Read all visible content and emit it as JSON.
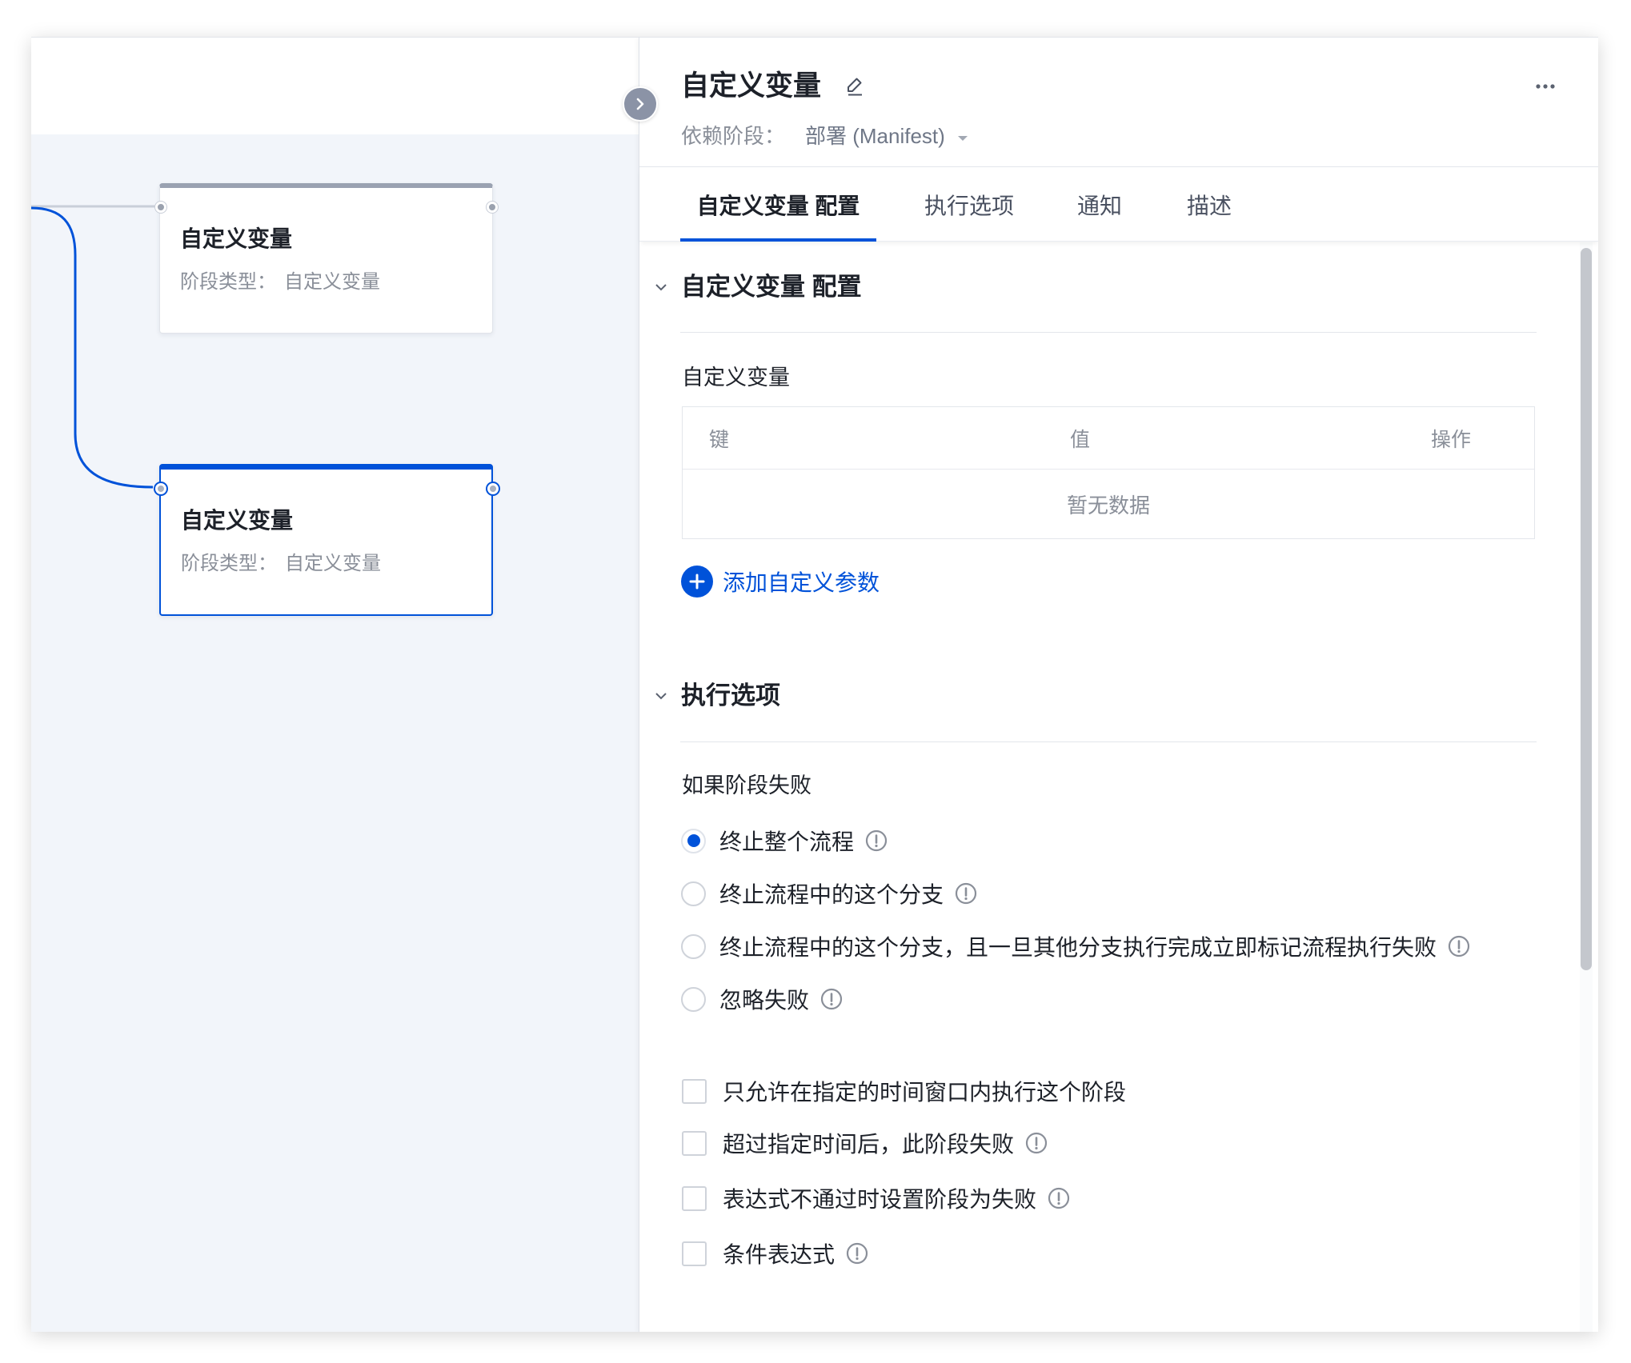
{
  "theme": {
    "accent": "#0052d9",
    "text_primary": "#1d2129",
    "text_secondary": "#8a8f99",
    "canvas_background": "#f2f5fa"
  },
  "canvas": {
    "collapse_icon": "chevron-right-icon",
    "nodes": [
      {
        "title": "自定义变量",
        "type_label": "阶段类型：",
        "type_value": "自定义变量",
        "selected": false
      },
      {
        "title": "自定义变量",
        "type_label": "阶段类型：",
        "type_value": "自定义变量",
        "selected": true
      }
    ]
  },
  "panel": {
    "title": "自定义变量",
    "title_icon": "pencil-icon",
    "more_icon": "more-horizontal-icon",
    "dependency": {
      "label": "依赖阶段：",
      "value": "部署 (Manifest)",
      "icon": "caret-down-icon"
    },
    "tabs": [
      {
        "label": "自定义变量 配置",
        "active": true
      },
      {
        "label": "执行选项",
        "active": false
      },
      {
        "label": "通知",
        "active": false
      },
      {
        "label": "描述",
        "active": false
      }
    ],
    "variables_section": {
      "heading": "自定义变量 配置",
      "expanded": true,
      "field_label": "自定义变量",
      "table": {
        "columns": [
          "键",
          "值",
          "操作"
        ],
        "rows": [],
        "empty_text": "暂无数据"
      },
      "add_button": {
        "label": "添加自定义参数",
        "icon": "plus-circle-icon"
      }
    },
    "execution_section": {
      "heading": "执行选项",
      "expanded": true,
      "failure_label": "如果阶段失败",
      "failure_options": [
        {
          "label": "终止整个流程",
          "selected": true,
          "has_info": true
        },
        {
          "label": "终止流程中的这个分支",
          "selected": false,
          "has_info": true
        },
        {
          "label": "终止流程中的这个分支，且一旦其他分支执行完成立即标记流程执行失败",
          "selected": false,
          "has_info": true
        },
        {
          "label": "忽略失败",
          "selected": false,
          "has_info": true
        }
      ],
      "checkboxes": [
        {
          "label": "只允许在指定的时间窗口内执行这个阶段",
          "checked": false,
          "has_info": false
        },
        {
          "label": "超过指定时间后，此阶段失败",
          "checked": false,
          "has_info": true
        },
        {
          "label": "表达式不通过时设置阶段为失败",
          "checked": false,
          "has_info": true
        },
        {
          "label": "条件表达式",
          "checked": false,
          "has_info": true
        }
      ]
    }
  }
}
